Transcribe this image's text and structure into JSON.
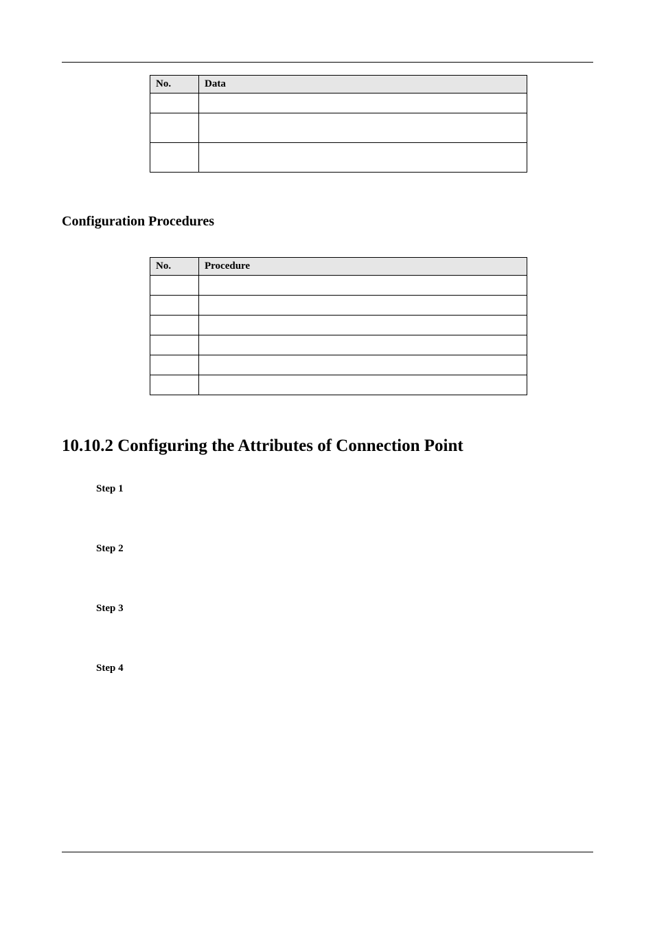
{
  "tables": {
    "data_table": {
      "headers": {
        "no": "No.",
        "data": "Data"
      },
      "rows": [
        {
          "no": "",
          "data": ""
        },
        {
          "no": "",
          "data": ""
        },
        {
          "no": "",
          "data": ""
        }
      ]
    },
    "procedure_table": {
      "headers": {
        "no": "No.",
        "procedure": "Procedure"
      },
      "rows": [
        {
          "no": "",
          "procedure": ""
        },
        {
          "no": "",
          "procedure": ""
        },
        {
          "no": "",
          "procedure": ""
        },
        {
          "no": "",
          "procedure": ""
        },
        {
          "no": "",
          "procedure": ""
        },
        {
          "no": "",
          "procedure": ""
        }
      ]
    }
  },
  "headings": {
    "config_procedures": "Configuration Procedures",
    "section_10_10_2": "10.10.2 Configuring the Attributes of Connection Point"
  },
  "steps": {
    "step1": "Step 1",
    "step2": "Step 2",
    "step3": "Step 3",
    "step4": "Step 4"
  }
}
